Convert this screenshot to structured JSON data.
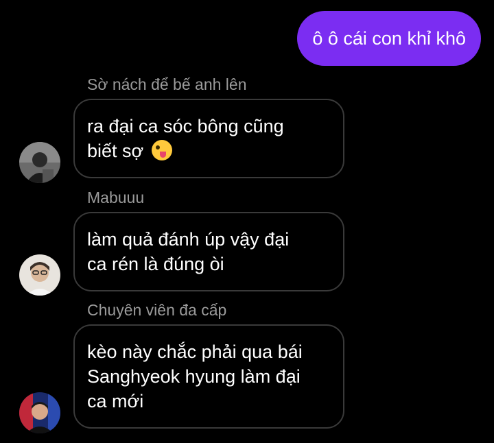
{
  "sent_message": {
    "text": "ô ô cái con khỉ khô"
  },
  "messages": [
    {
      "sender": "Sờ nách để bế anh lên",
      "lines": [
        "ra đại ca sóc bông cũng",
        "biết sợ"
      ],
      "emoji": "zany-face-emoji"
    },
    {
      "sender": "Mabuuu",
      "lines": [
        "làm quả đánh úp vậy đại",
        "ca rén là đúng òi"
      ]
    },
    {
      "sender": "Chuyên viên đa cấp",
      "lines": [
        "kèo này chắc phải qua bái",
        "Sanghyeok hyung làm đại",
        "ca mới"
      ]
    }
  ],
  "colors": {
    "background": "#000000",
    "sent_bubble": "#7b2df2",
    "received_border": "#3a3a3a",
    "sender_name": "#9a9a9a",
    "text": "#ffffff"
  }
}
